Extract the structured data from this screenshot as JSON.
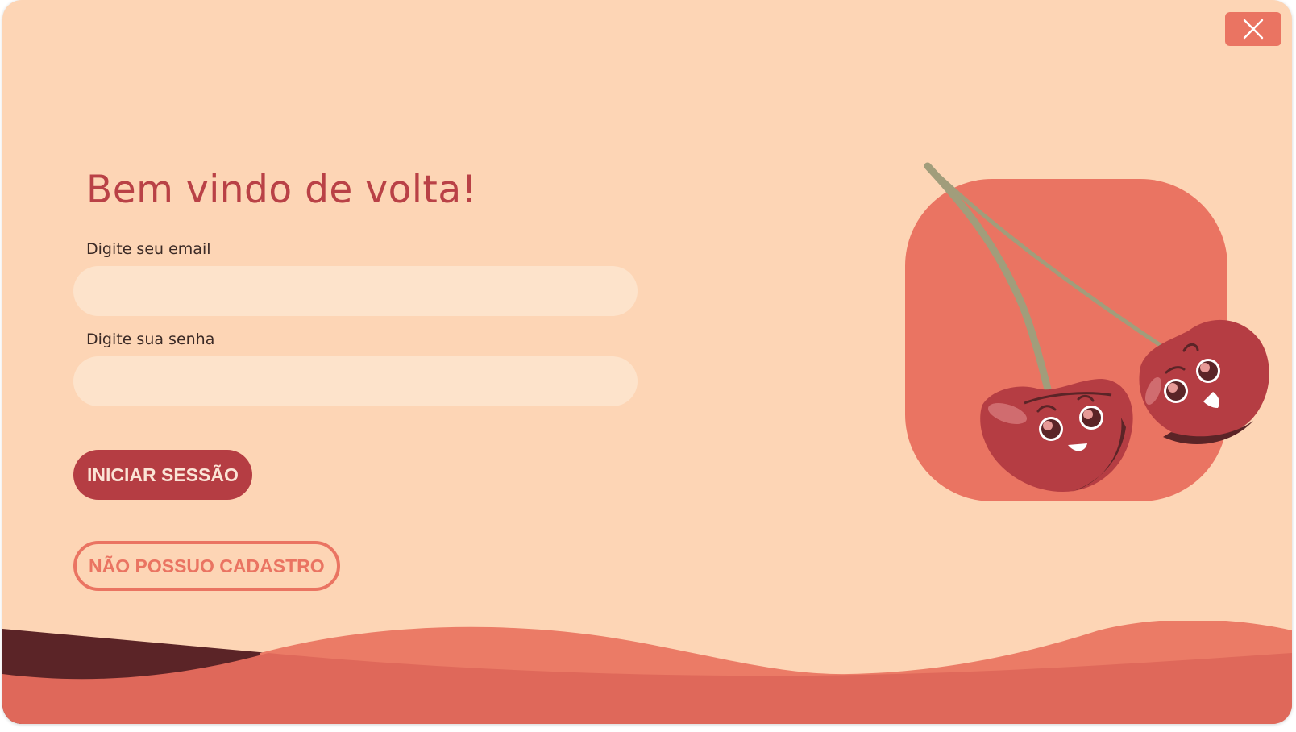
{
  "window": {
    "close_icon": "close-icon",
    "close_button_color": "#ea7462"
  },
  "login": {
    "title": "Bem vindo de volta!",
    "email_label": "Digite seu email",
    "email_value": "",
    "email_placeholder": "",
    "password_label": "Digite sua senha",
    "password_value": "",
    "password_placeholder": "",
    "submit_label": "INICIAR SESSÃO",
    "signup_label": "NÃO POSSUO CADASTRO"
  },
  "illustration": {
    "icon": "cherries-illustration"
  },
  "colors": {
    "background": "#fdd5b5",
    "accent": "#ea7462",
    "primary": "#b53d43",
    "input_background": "#fde3cb",
    "dark": "#5b2427"
  }
}
